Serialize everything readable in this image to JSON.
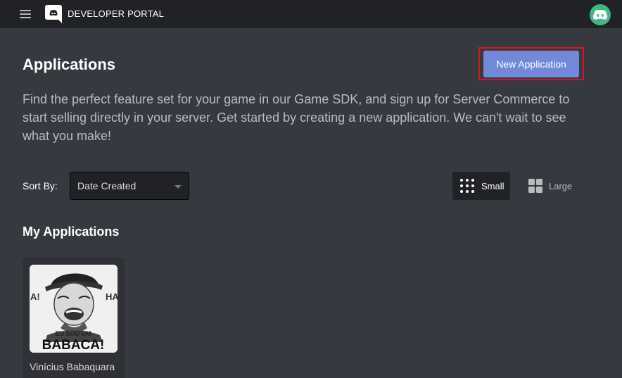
{
  "topbar": {
    "menu_icon": "hamburger-icon",
    "logo_icon": "discord-logo-icon",
    "brand": "DEVELOPER PORTAL",
    "avatar_icon": "discord-avatar-icon"
  },
  "colors": {
    "background": "#36393f",
    "topbar": "#202225",
    "accent": "#7289da",
    "highlight": "#e0131d",
    "avatar": "#43b581",
    "card": "#2f3136"
  },
  "header": {
    "title": "Applications",
    "new_app_label": "New Application"
  },
  "description": "Find the perfect feature set for your game in our Game SDK, and sign up for Server Commerce to start selling directly in your server. Get started by creating a new application. We can't wait to see what you make!",
  "sort": {
    "label": "Sort By:",
    "selected": "Date Created"
  },
  "view_toggle": {
    "small_label": "Small",
    "small_icon": "grid-dots-icon",
    "large_label": "Large",
    "large_icon": "grid-squares-icon",
    "active": "Small"
  },
  "my_apps": {
    "title": "My Applications",
    "items": [
      {
        "name": "Vinícius Babaquara",
        "icon_text_top": "EU SOU UM",
        "icon_text_bottom": "BABACA!",
        "icon_side_left": "A!",
        "icon_side_right": "HA"
      }
    ]
  }
}
